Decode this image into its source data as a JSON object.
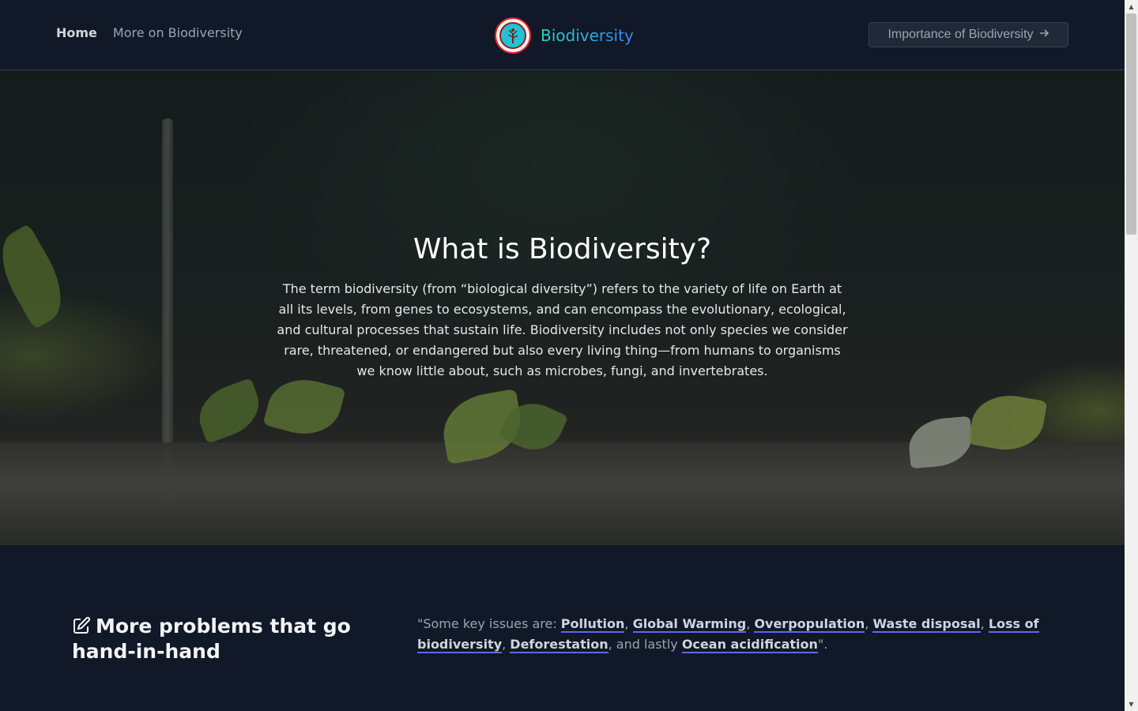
{
  "header": {
    "nav": [
      {
        "label": "Home"
      },
      {
        "label": "More on Biodiversity"
      }
    ],
    "brand": "Biodiversity",
    "cta_label": "Importance of Biodiversity",
    "cta_icon": "arrow-right-icon",
    "logo_icon": "tree-emblem-icon"
  },
  "progress": {
    "fraction": 0.2
  },
  "hero": {
    "title": "What is Biodiversity?",
    "text": "The term biodiversity (from “biological diversity”) refers to the variety of life on Earth at all its levels, from genes to ecosystems, and can encompass the evolutionary, ecological, and cultural processes that sustain life. Biodiversity includes not only species we consider rare, threatened, or endangered but also every living thing—from humans to organisms we know little about, such as microbes, fungi, and invertebrates."
  },
  "problems": {
    "title": "More problems that go hand-in-hand",
    "title_icon": "edit-icon",
    "intro": "\"Some key issues are: ",
    "issues": [
      "Pollution",
      "Global Warming",
      "Overpopulation",
      "Waste disposal",
      "Loss of biodiversity",
      "Deforestation",
      "Ocean acidification"
    ],
    "sep": ", ",
    "lastly": ", and lastly ",
    "end": "\"."
  },
  "colors": {
    "background": "#111827",
    "accent": "#6366f1",
    "brand_gradient_start": "#2dd4bf",
    "brand_gradient_end": "#3b82f6"
  }
}
